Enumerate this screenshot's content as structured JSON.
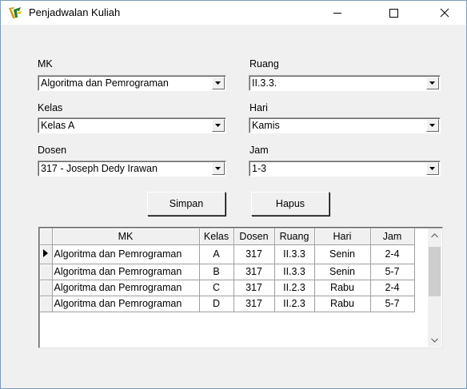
{
  "window": {
    "title": "Penjadwalan Kuliah",
    "icons": {
      "app": "delphi-app-icon",
      "minimize": "minimize-icon",
      "maximize": "maximize-icon",
      "close": "close-icon"
    }
  },
  "form": {
    "mk": {
      "label": "MK",
      "value": "Algoritma dan Pemrograman"
    },
    "kelas": {
      "label": "Kelas",
      "value": "Kelas A"
    },
    "dosen": {
      "label": "Dosen",
      "value": "317 - Joseph Dedy Irawan"
    },
    "ruang": {
      "label": "Ruang",
      "value": "II.3.3."
    },
    "hari": {
      "label": "Hari",
      "value": "Kamis"
    },
    "jam": {
      "label": "Jam",
      "value": "1-3"
    }
  },
  "buttons": {
    "simpan": "Simpan",
    "hapus": "Hapus"
  },
  "grid": {
    "columns": [
      "MK",
      "Kelas",
      "Dosen",
      "Ruang",
      "Hari",
      "Jam"
    ],
    "rows": [
      {
        "mk": "Algoritma dan Pemrograman",
        "kelas": "A",
        "dosen": "317",
        "ruang": "II.3.3",
        "hari": "Senin",
        "jam": "2-4"
      },
      {
        "mk": "Algoritma dan Pemrograman",
        "kelas": "B",
        "dosen": "317",
        "ruang": "II.3.3",
        "hari": "Senin",
        "jam": "5-7"
      },
      {
        "mk": "Algoritma dan Pemrograman",
        "kelas": "C",
        "dosen": "317",
        "ruang": "II.2.3",
        "hari": "Rabu",
        "jam": "2-4"
      },
      {
        "mk": "Algoritma dan Pemrograman",
        "kelas": "D",
        "dosen": "317",
        "ruang": "II.2.3",
        "hari": "Rabu",
        "jam": "5-7"
      }
    ],
    "current_row": 0
  }
}
